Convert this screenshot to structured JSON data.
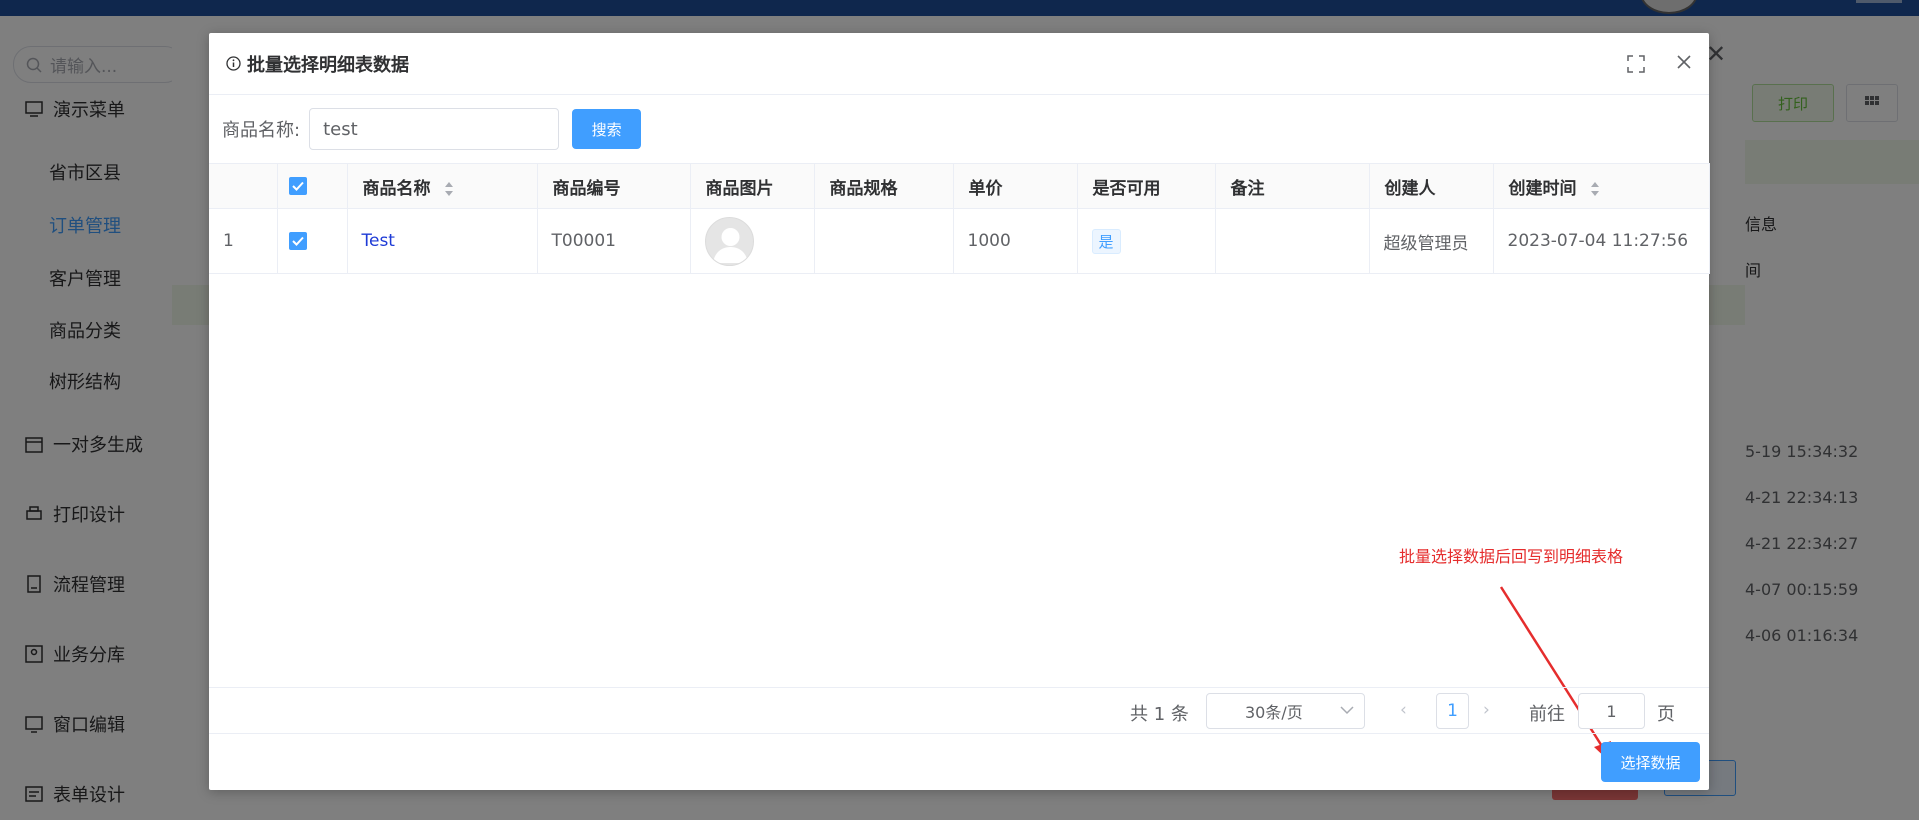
{
  "background": {
    "search_placeholder": "请输入...",
    "menu": [
      {
        "label": "演示菜单",
        "icon": "monitor-icon"
      },
      {
        "label": "一对多生成",
        "icon": "calendar-icon"
      },
      {
        "label": "打印设计",
        "icon": "printer-icon"
      },
      {
        "label": "流程管理",
        "icon": "document-icon"
      },
      {
        "label": "业务分库",
        "icon": "user-box-icon"
      },
      {
        "label": "窗口编辑",
        "icon": "window-icon"
      },
      {
        "label": "表单设计",
        "icon": "form-icon"
      }
    ],
    "submenu": [
      {
        "label": "省市区县",
        "active": false
      },
      {
        "label": "订单管理",
        "active": true
      },
      {
        "label": "客户管理",
        "active": false
      },
      {
        "label": "商品分类",
        "active": false
      },
      {
        "label": "树形结构",
        "active": false
      }
    ],
    "print_label": "打印",
    "right_labels": [
      "信息",
      "间"
    ],
    "right_times": [
      "5-19 15:34:32",
      "4-21 22:34:13",
      "4-21 22:34:27",
      "4-07 00:15:59",
      "4-06 01:16:34"
    ]
  },
  "modal": {
    "title": "批量选择明细表数据",
    "search": {
      "label": "商品名称:",
      "value": "test",
      "button": "搜索"
    },
    "columns": [
      "",
      "",
      "商品名称",
      "商品编号",
      "商品图片",
      "商品规格",
      "单价",
      "是否可用",
      "备注",
      "创建人",
      "创建时间"
    ],
    "rows": [
      {
        "index": "1",
        "checked": true,
        "name": "Test",
        "code": "T00001",
        "image": "avatar-placeholder",
        "spec": "",
        "price": "1000",
        "available": "是",
        "remark": "",
        "creator": "超级管理员",
        "created_at": "2023-07-04 11:27:56"
      }
    ],
    "pager": {
      "total": "共 1 条",
      "page_size": "30条/页",
      "current": "1",
      "goto_label": "前往",
      "goto_value": "1",
      "page_suffix": "页"
    },
    "annotation": "批量选择数据后回写到明细表格",
    "select_button": "选择数据"
  },
  "colors": {
    "primary": "#409eff",
    "annotation": "#e52d2d",
    "link": "#1e3bd6"
  }
}
